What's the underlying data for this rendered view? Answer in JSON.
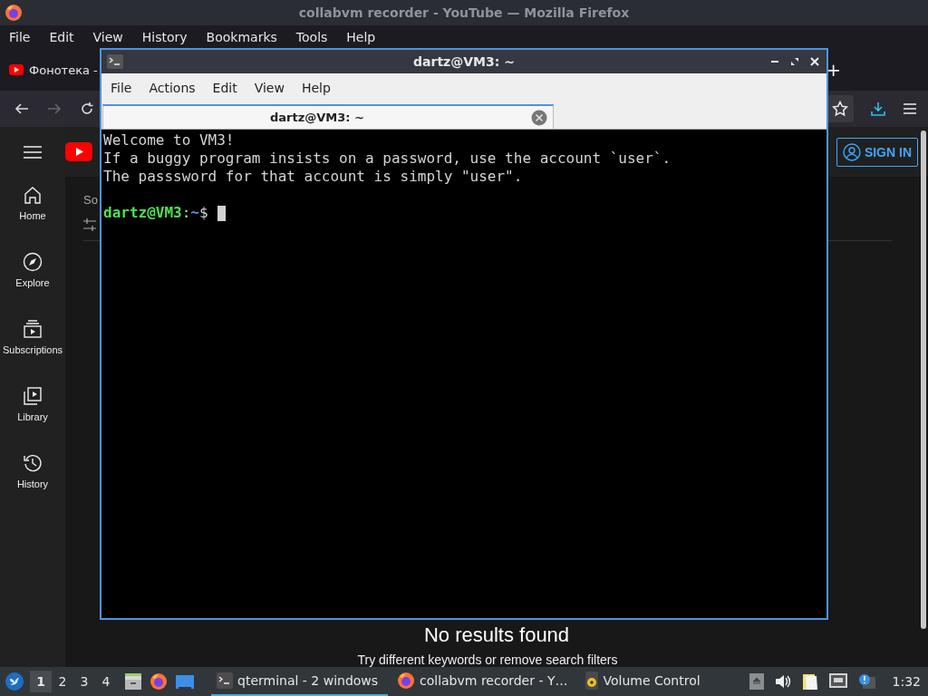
{
  "browser": {
    "title": "collabvm recorder - YouTube — Mozilla Firefox",
    "menu": [
      "File",
      "Edit",
      "View",
      "History",
      "Bookmarks",
      "Tools",
      "Help"
    ],
    "tab": "Фонотека -",
    "new_tab": "+",
    "page": {
      "sidebar": [
        {
          "label": "Home",
          "kind": "home"
        },
        {
          "label": "Explore",
          "kind": "explore"
        },
        {
          "label": "Subscriptions",
          "kind": "subscriptions"
        },
        {
          "label": "Library",
          "kind": "library"
        },
        {
          "label": "History",
          "kind": "history"
        }
      ],
      "search_text": "So",
      "sign_in": "SIGN IN",
      "empty_title": "No results found",
      "empty_hint": "Try different keywords or remove search filters"
    }
  },
  "terminal": {
    "title": "dartz@VM3: ~",
    "menu": [
      "File",
      "Actions",
      "Edit",
      "View",
      "Help"
    ],
    "tab": "dartz@VM3: ~",
    "lines": [
      "Welcome to VM3!",
      "If a buggy program insists on a password, use the account `user`.",
      "The passsword for that account is simply \"user\"."
    ],
    "prompt": {
      "user_host": "dartz@VM3",
      "separator": ":",
      "path": "~",
      "symbol": "$"
    }
  },
  "taskbar": {
    "desktops": [
      {
        "label": "1",
        "selected": true
      },
      {
        "label": "2",
        "selected": false
      },
      {
        "label": "3",
        "selected": false
      },
      {
        "label": "4",
        "selected": false
      }
    ],
    "tasks": [
      {
        "label": "qterminal - 2 windows",
        "kind": "terminal",
        "selected": true
      },
      {
        "label": "collabvm recorder - Y…",
        "kind": "firefox",
        "selected": false
      },
      {
        "label": "Volume Control",
        "kind": "volume",
        "selected": false
      }
    ],
    "clock": "1:32"
  }
}
